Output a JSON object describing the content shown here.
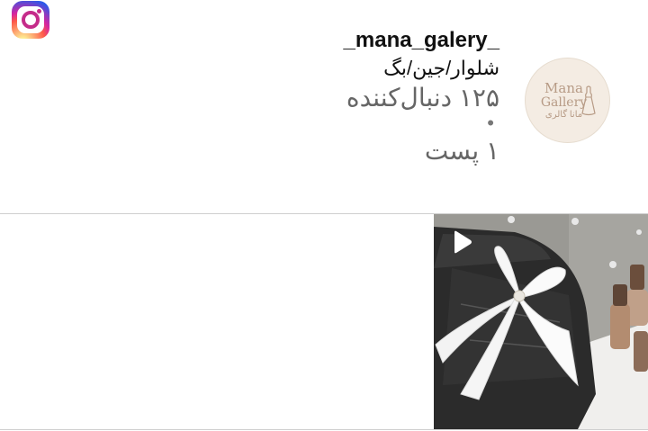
{
  "app": {
    "logo_icon": "instagram-logo-icon"
  },
  "profile": {
    "username": "_mana_galery_",
    "bio": "شلوار/جین/بگ",
    "followers": "۱۲۵ دنبال‌کننده",
    "separator": "•",
    "posts": "۱ پست",
    "avatar": {
      "brand_line1": "Mana",
      "brand_line2": "Gallery",
      "brand_fa": "مانا گالری",
      "colors": {
        "background": "#f4ece3",
        "text": "#b79b86"
      }
    }
  },
  "posts_grid": {
    "items": [
      {
        "type": "reel",
        "icon": "play-reel-icon"
      }
    ]
  },
  "colors": {
    "divider": "#cfcfcf",
    "muted_text": "#666666",
    "primary_text": "#111111"
  }
}
